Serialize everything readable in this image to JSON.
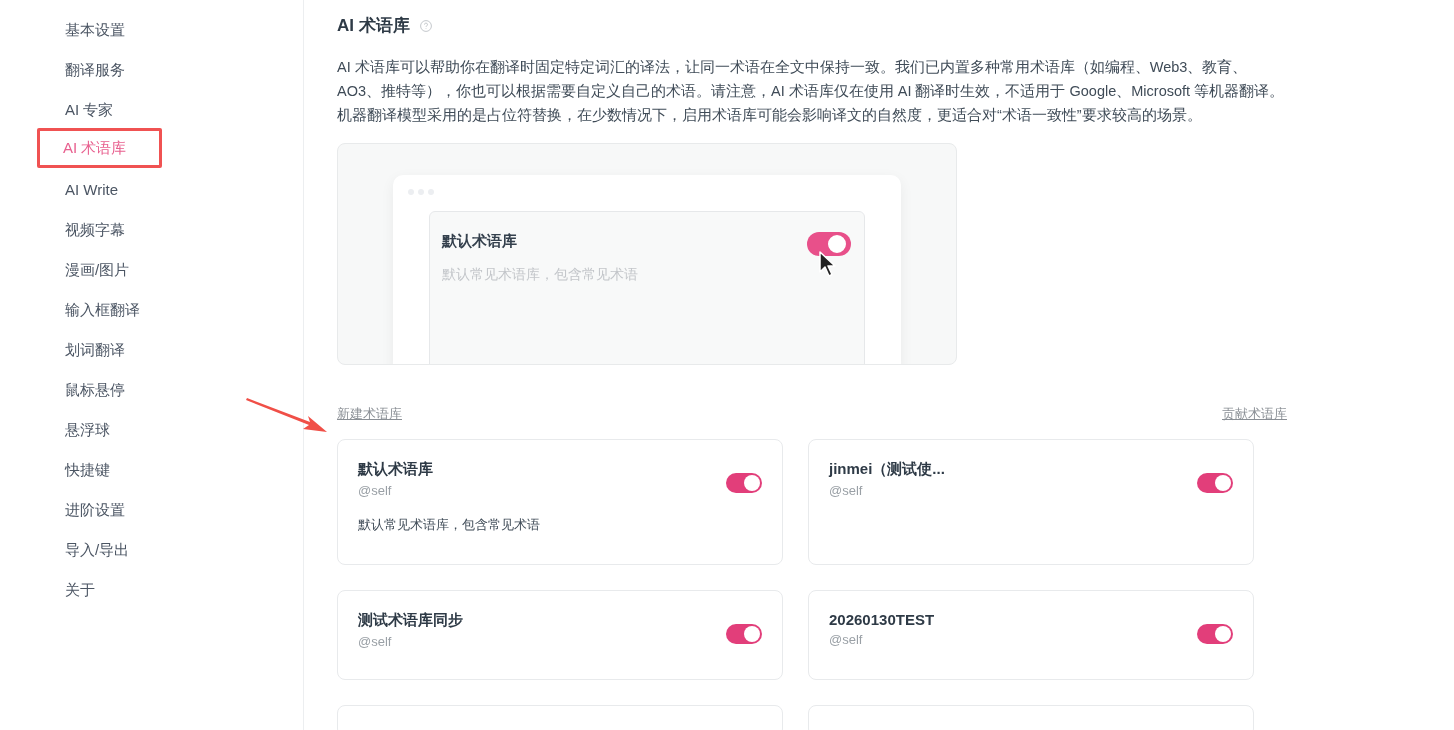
{
  "sidebar": {
    "items": [
      {
        "label": "基本设置",
        "selected": false
      },
      {
        "label": "翻译服务",
        "selected": false
      },
      {
        "label": "AI 专家",
        "selected": false
      },
      {
        "label": "AI 术语库",
        "selected": true
      },
      {
        "label": "AI Write",
        "selected": false
      },
      {
        "label": "视频字幕",
        "selected": false
      },
      {
        "label": "漫画/图片",
        "selected": false
      },
      {
        "label": "输入框翻译",
        "selected": false
      },
      {
        "label": "划词翻译",
        "selected": false
      },
      {
        "label": "鼠标悬停",
        "selected": false
      },
      {
        "label": "悬浮球",
        "selected": false
      },
      {
        "label": "快捷键",
        "selected": false
      },
      {
        "label": "进阶设置",
        "selected": false
      },
      {
        "label": "导入/导出",
        "selected": false
      },
      {
        "label": "关于",
        "selected": false
      }
    ]
  },
  "section": {
    "title": "AI 术语库",
    "description": "AI 术语库可以帮助你在翻译时固定特定词汇的译法，让同一术语在全文中保持一致。我们已内置多种常用术语库（如编程、Web3、教育、AO3、推特等），你也可以根据需要自定义自己的术语。请注意，AI 术语库仅在使用 AI 翻译时生效，不适用于 Google、Microsoft 等机器翻译。机器翻译模型采用的是占位符替换，在少数情况下，启用术语库可能会影响译文的自然度，更适合对“术语一致性”要求较高的场景。",
    "preview": {
      "name": "默认术语库",
      "description": "默认常见术语库，包含常见术语",
      "on": true
    },
    "new_link": "新建术语库",
    "contribute_link": "贡献术语库",
    "glossaries": [
      {
        "name": "默认术语库",
        "author": "@self",
        "description": "默认常见术语库，包含常见术语",
        "on": true
      },
      {
        "name": "jinmei（测试使...",
        "author": "@self",
        "on": true
      },
      {
        "name": "测试术语库同步",
        "author": "@self",
        "on": true
      },
      {
        "name": "20260130TEST",
        "author": "@self",
        "on": true
      }
    ]
  }
}
